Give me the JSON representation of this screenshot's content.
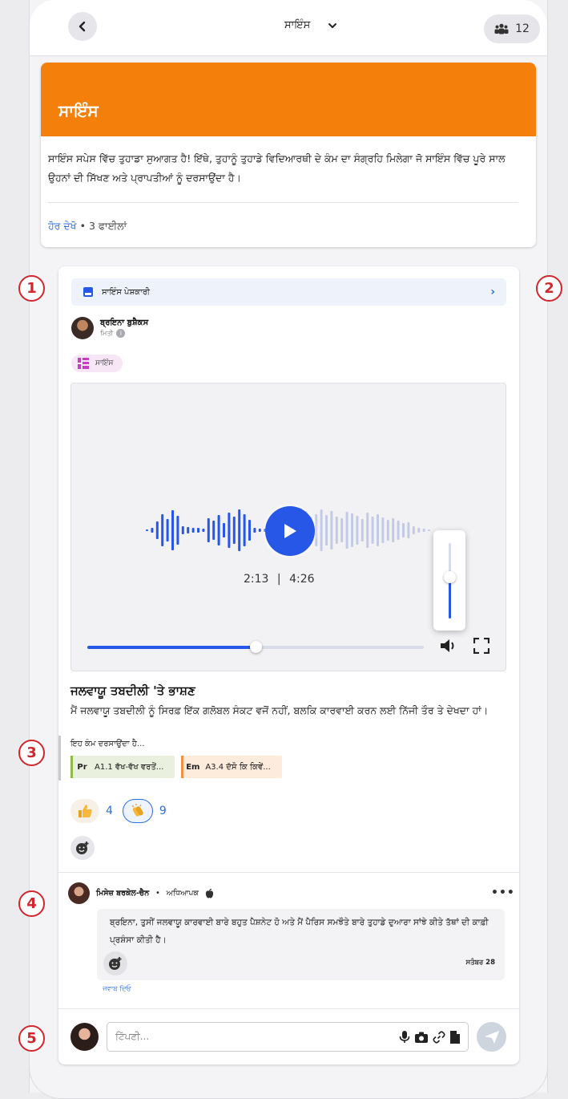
{
  "header": {
    "space_title": "ਸਾਇੰਸ",
    "member_count": "12"
  },
  "hero": {
    "title": "ਸਾਇੰਸ",
    "description": "ਸਾਇੰਸ ਸਪੇਸ ਵਿੱਚ ਤੁਹਾਡਾ ਸੁਆਗਤ ਹੈ! ਇੱਥੇ, ਤੁਹਾਨੂੰ ਤੁਹਾਡੇ ਵਿਦਿਆਰਥੀ ਦੇ ਕੰਮ ਦਾ ਸੰਗ੍ਰਹਿ ਮਿਲੇਗਾ ਜੋ ਸਾਇੰਸ ਵਿੱਚ ਪੂਰੇ ਸਾਲ ਉਹਨਾਂ ਦੀ ਸਿੱਖਣ ਅਤੇ ਪ੍ਰਾਪਤੀਆਂ ਨੂੰ ਦਰਸਾਉਂਦਾ ਹੈ।",
    "see_more": "ਹੋਰ ਦੇਖੋ",
    "bullet": "•",
    "files": "3 ਫਾਈਲਾਂ"
  },
  "post": {
    "portfolio_label": "ਸਾਇੰਸ ਪੇਸ਼ਕਾਰੀ",
    "author_name": "ਬ੍ਰਇਨਾ ਬੁਸ਼ੈਕਸ",
    "author_sub": "ਮਿਤੀ",
    "info_icon_char": "i",
    "tag_label": "ਸਾਇੰਸ",
    "player": {
      "current_time": "2:13",
      "separator": "|",
      "total_time": "4:26",
      "progress_fraction": 0.5,
      "volume_fraction": 0.55
    },
    "title": "ਜਲਵਾਯੂ ਤਬਦੀਲੀ 'ਤੇ ਭਾਸ਼ਣ",
    "description": "ਮੈਂ ਜਲਵਾਯੂ ਤਬਦੀਲੀ ਨੂੰ ਸਿਰਫ਼ ਇੱਕ ਗਲੋਬਲ ਸੰਕਟ ਵਜੋਂ ਨਹੀਂ, ਬਲਕਿ ਕਾਰਵਾਈ ਕਰਨ ਲਈ ਨਿੱਜੀ ਤੌਰ ਤੇ ਦੇਖਦਾ ਹਾਂ।",
    "evidence_label": "ਇਹ ਕੰਮ ਦਰਸਾਉਂਦਾ ਹੈ...",
    "skills": [
      {
        "abbr": "Pr",
        "label": "A1.1 ਵੱਖ-ਵੱਖ ਵਰਤੋਂ...",
        "color": "#8dbb4a"
      },
      {
        "abbr": "Em",
        "label": "A3.4 ਦੱਸੋ ਕਿ ਕਿਵੇਂ...",
        "color": "#f29340"
      }
    ],
    "reactions": [
      {
        "icon": "thumbs-up-icon",
        "count": "4"
      },
      {
        "icon": "clapping-hands-icon",
        "count": "9"
      }
    ]
  },
  "comment": {
    "author": "ਮਿਸੇਜ਼ ਬਰਕੇਲ-ਚੈਨ",
    "bullet": "•",
    "role": "ਅਧਿਆਪਕ",
    "more_label": "•••",
    "text": "ਬ੍ਰਇਨਾ, ਤੁਸੀਂ ਜਲਵਾਯੂ ਕਾਰਵਾਈ ਬਾਰੇ ਬਹੁਤ ਪੈਸ਼ਨੇਟ ਹੋ ਅਤੇ ਮੈਂ ਪੈਰਿਸ ਸਮਝੌਤੇ ਬਾਰੇ ਤੁਹਾਡੇ ਦੁਆਰਾ ਸਾਂਝੇ ਕੀਤੇ ਤੱਥਾਂ ਦੀ ਕਾਫ਼ੀ ਪ੍ਰਸ਼ੰਸਾ ਕੀਤੀ ਹੈ।",
    "date": "ਸਤੰਬਰ 28",
    "reply_label": "ਜਵਾਬ ਦਿਓ"
  },
  "composer": {
    "placeholder": "ਟਿੱਪਣੀ..."
  },
  "annotations": [
    "1",
    "2",
    "3",
    "4",
    "5"
  ],
  "colors": {
    "accent": "#2657e6",
    "hero": "#f47f0a",
    "badge": "#d0262d"
  }
}
